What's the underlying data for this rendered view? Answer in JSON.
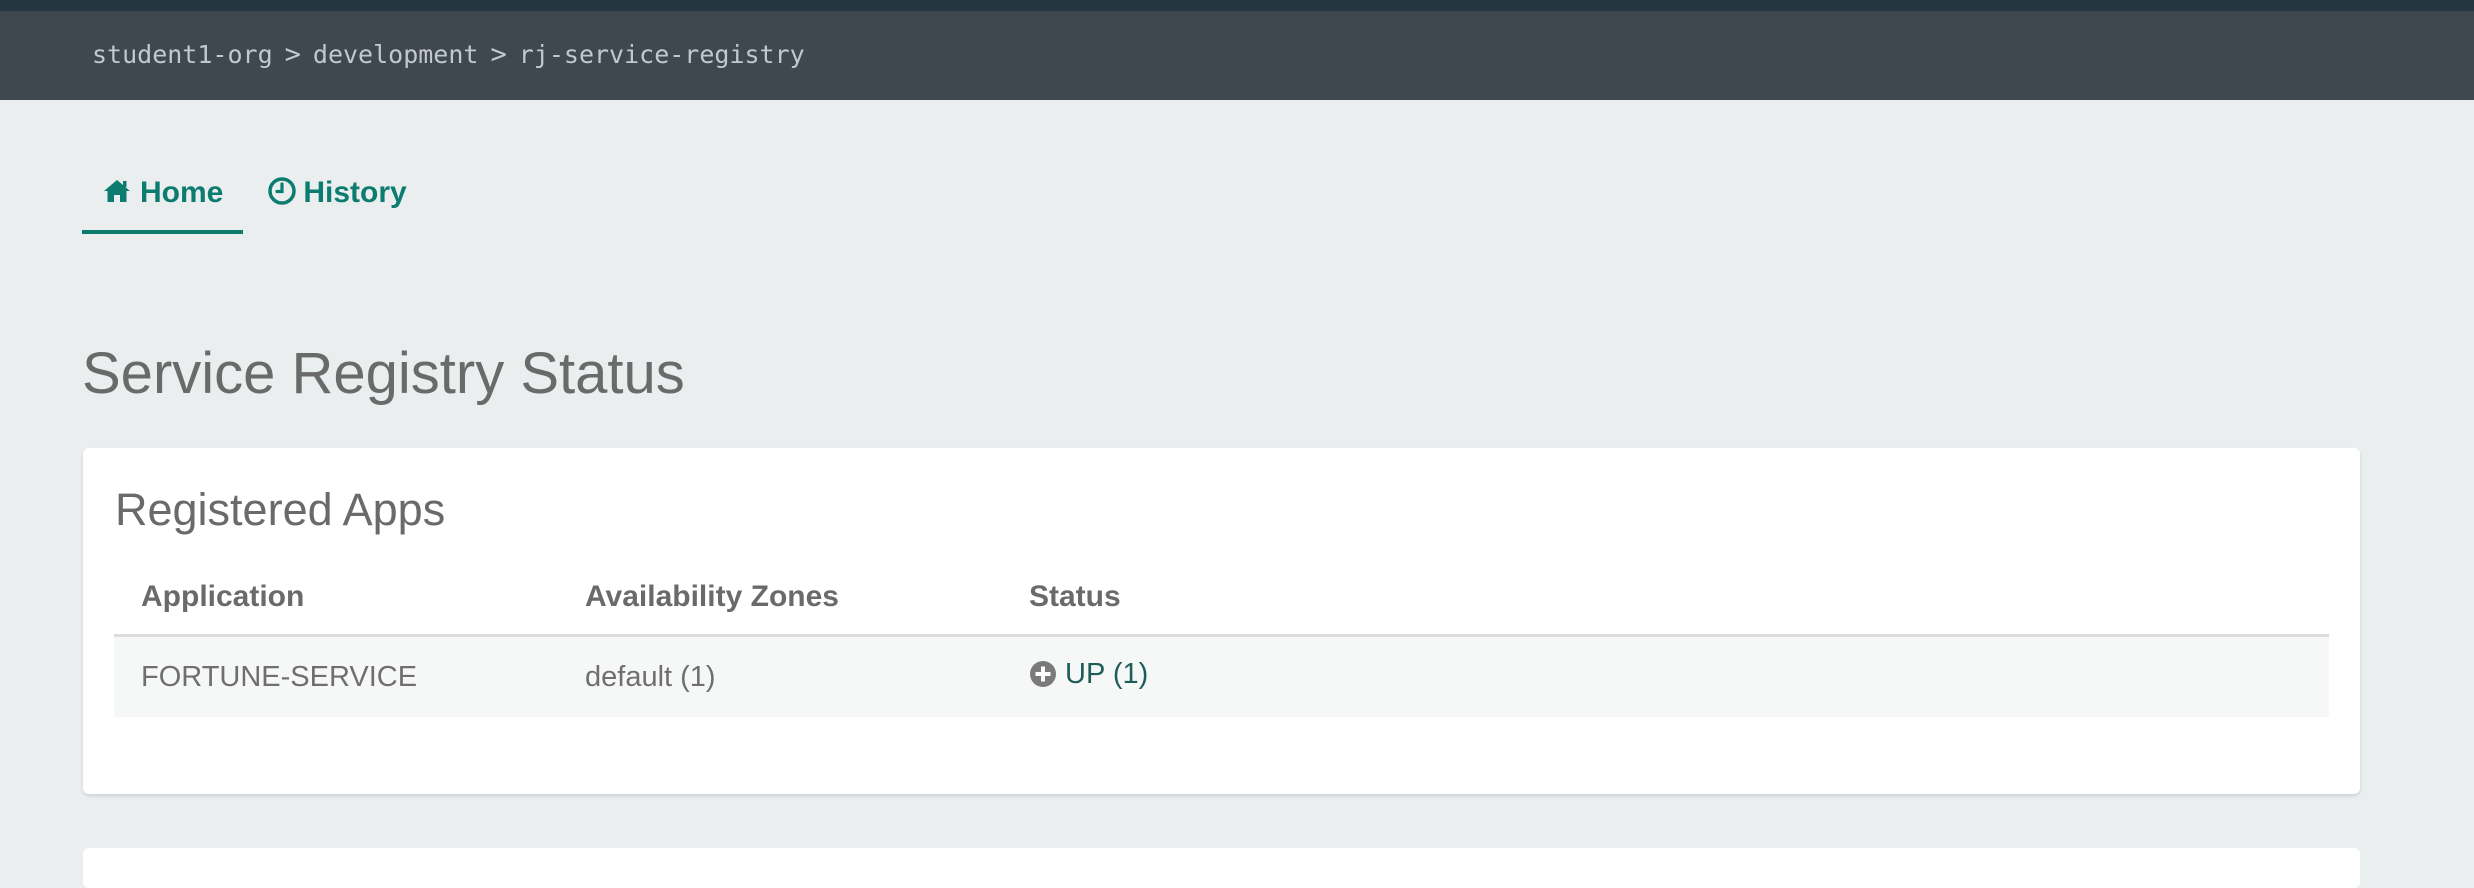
{
  "breadcrumb": {
    "items": [
      "student1-org",
      "development",
      "rj-service-registry"
    ],
    "separator": ">"
  },
  "tabs": [
    {
      "label": "Home",
      "icon": "home-icon",
      "active": true
    },
    {
      "label": "History",
      "icon": "clock-icon",
      "active": false
    }
  ],
  "page_title": "Service Registry Status",
  "registered_apps": {
    "title": "Registered Apps",
    "columns": [
      "Application",
      "Availability Zones",
      "Status"
    ],
    "rows": [
      {
        "application": "FORTUNE-SERVICE",
        "zones": "default (1)",
        "status": "UP (1)",
        "status_icon": "plus-circle-icon"
      }
    ]
  },
  "colors": {
    "accent": "#0c7c70",
    "header_bg": "#3f474f",
    "page_bg": "#eaeeef",
    "status_link": "#1d5e58"
  }
}
